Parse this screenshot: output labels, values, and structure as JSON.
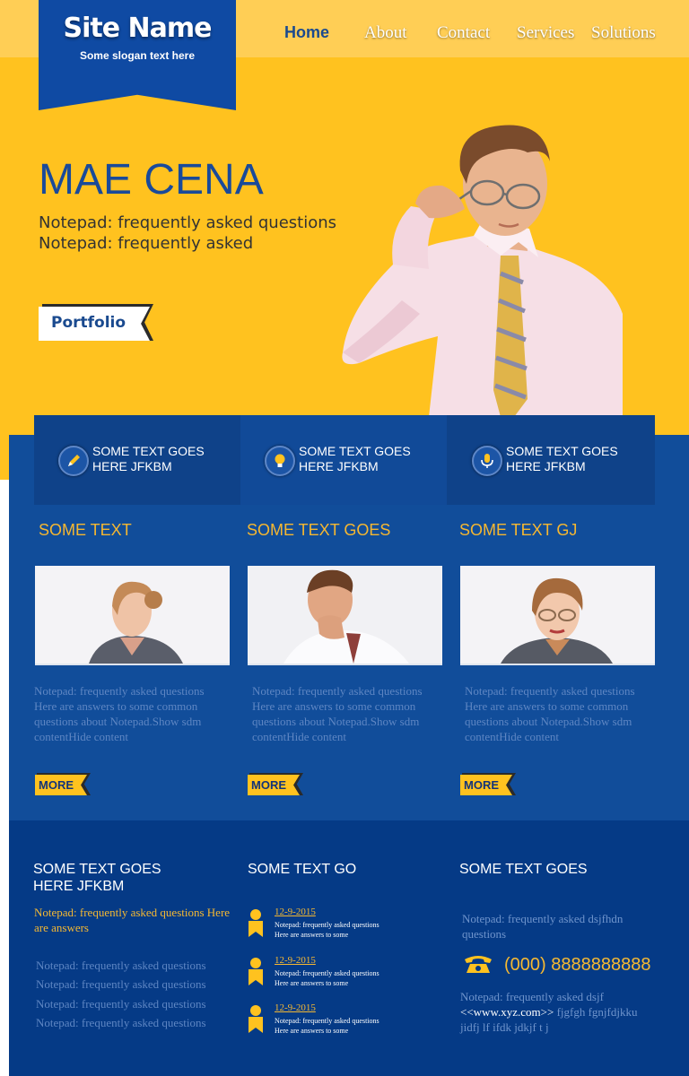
{
  "header": {
    "site_name": "Site Name",
    "slogan": "Some slogan text here",
    "nav": [
      "Home",
      "About",
      "Contact",
      "Services",
      "Solutions"
    ]
  },
  "hero": {
    "heading": "MAE CENA",
    "line1": "Notepad: frequently asked questions",
    "line2": "Notepad: frequently asked",
    "button": "Portfolio"
  },
  "features": [
    {
      "icon": "pencil-icon",
      "text": "SOME TEXT GOES HERE JFKBM"
    },
    {
      "icon": "lightbulb-icon",
      "text": "SOME TEXT GOES HERE JFKBM"
    },
    {
      "icon": "microphone-icon",
      "text": "SOME TEXT GOES HERE JFKBM"
    }
  ],
  "columns": [
    {
      "title": "SOME TEXT",
      "text": "Notepad: frequently asked questions Here are answers to some common questions about Notepad.Show sdm contentHide content",
      "more": "MORE"
    },
    {
      "title": "SOME TEXT GOES",
      "text": "Notepad: frequently asked questions Here are answers to some common questions about Notepad.Show sdm contentHide content",
      "more": "MORE"
    },
    {
      "title": "SOME TEXT GJ",
      "text": "Notepad: frequently asked questions Here are answers to some common questions about Notepad.Show sdm contentHide content",
      "more": "MORE"
    }
  ],
  "footer": {
    "col1": {
      "title": "SOME TEXT GOES HERE JFKBM",
      "highlight": "Notepad: frequently asked questions Here are answers",
      "links": [
        "Notepad: frequently asked questions",
        "Notepad: frequently asked questions",
        "Notepad: frequently asked questions",
        "Notepad: frequently asked questions"
      ]
    },
    "col2": {
      "title": "SOME TEXT GO",
      "events": [
        {
          "date": "12-9-2015",
          "line1": "Notepad: frequently asked questions",
          "line2": "Here are answers to some"
        },
        {
          "date": "12-9-2015",
          "line1": "Notepad: frequently asked questions",
          "line2": "Here are answers to some"
        },
        {
          "date": "12-9-2015",
          "line1": "Notepad: frequently asked questions",
          "line2": "Here are answers to some"
        }
      ]
    },
    "col3": {
      "title": "SOME TEXT GOES",
      "note": "Notepad: frequently asked dsjfhdn questions",
      "phone": "(000) 8888888888",
      "contact_pre": "Notepad: frequently asked dsjf",
      "url": "<<www.xyz.com>>",
      "contact_post": "fjgfgh fgnjfdjkku jidfj lf ifdk jdkjf t j"
    }
  },
  "colors": {
    "yellow": "#ffc21f",
    "blue": "#114d9a",
    "dark_blue": "#053a86",
    "accent_text": "#f6b932"
  }
}
